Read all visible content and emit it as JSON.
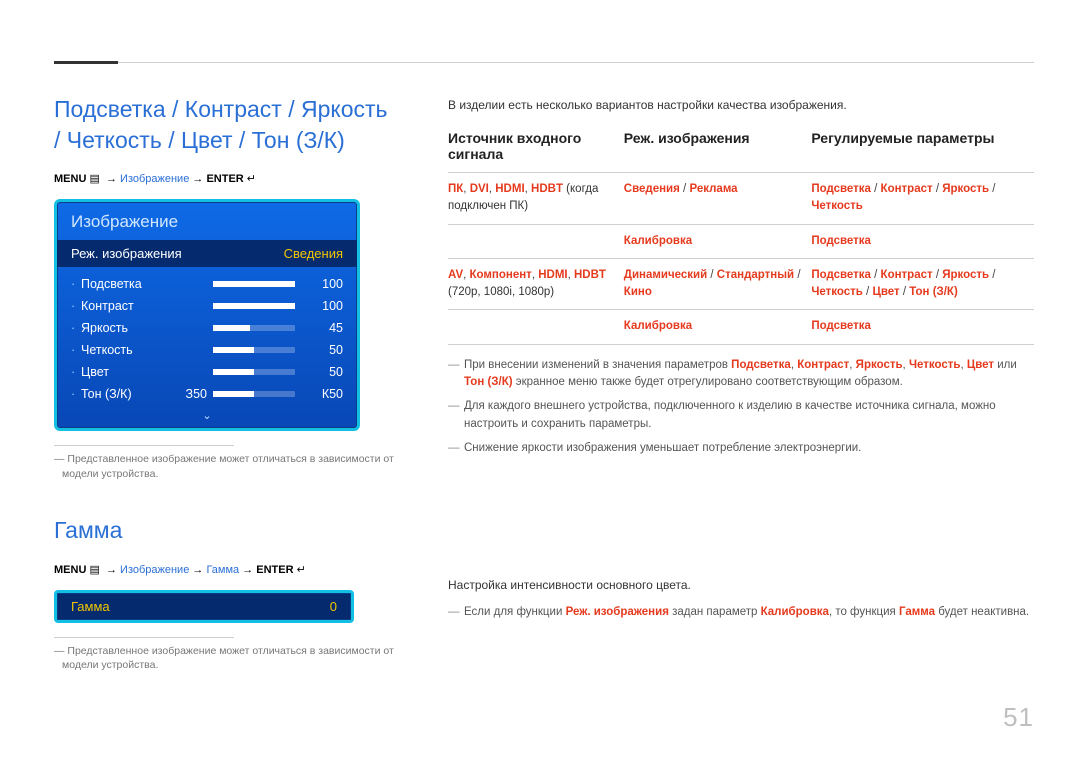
{
  "page_number": "51",
  "section1": {
    "title": "Подсветка / Контраст / Яркость / Четкость / Цвет / Тон (З/К)",
    "menu_path_prefix": "MENU",
    "menu_path_items": [
      "Изображение",
      "ENTER"
    ],
    "osd_title": "Изображение",
    "osd_selected_label": "Реж. изображения",
    "osd_selected_value": "Сведения",
    "sliders": [
      {
        "label": "Подсветка",
        "pre": "",
        "value": "100",
        "pct": 100
      },
      {
        "label": "Контраст",
        "pre": "",
        "value": "100",
        "pct": 100
      },
      {
        "label": "Яркость",
        "pre": "",
        "value": "45",
        "pct": 45
      },
      {
        "label": "Четкость",
        "pre": "",
        "value": "50",
        "pct": 50
      },
      {
        "label": "Цвет",
        "pre": "",
        "value": "50",
        "pct": 50
      },
      {
        "label": "Тон (З/К)",
        "pre": "З50",
        "value": "К50",
        "pct": 50
      }
    ],
    "footnote": "Представленное изображение может отличаться в зависимости от модели устройства."
  },
  "section2": {
    "title": "Гамма",
    "menu_path_prefix": "MENU",
    "menu_path_items": [
      "Изображение",
      "Гамма",
      "ENTER"
    ],
    "osd_label": "Гамма",
    "osd_value": "0",
    "footnote": "Представленное изображение может отличаться в зависимости от модели устройства."
  },
  "right": {
    "lead": "В изделии есть несколько вариантов настройки качества изображения.",
    "headers": [
      "Источник входного сигнала",
      "Реж. изображения",
      "Регулируемые параметры"
    ],
    "rows": [
      {
        "c1_red": "ПК, DVI, HDMI, HDBT",
        "c1_plain": " (когда подключен ПК)",
        "c2": "Сведения / Реклама",
        "c3": "Подсветка / Контраст / Яркость / Четкость"
      },
      {
        "c1_red": "",
        "c1_plain": "",
        "c2": "Калибровка",
        "c3": "Подсветка"
      },
      {
        "c1_red": "AV, Компонент, HDMI, HDBT",
        "c1_plain": " (720p, 1080i, 1080p)",
        "c2": "Динамический / Стандартный / Кино",
        "c3": "Подсветка / Контраст / Яркость / Четкость / Цвет / Тон (З/К)"
      },
      {
        "c1_red": "",
        "c1_plain": "",
        "c2": "Калибровка",
        "c3": "Подсветка"
      }
    ],
    "notes": [
      {
        "pre": "При внесении изменений в значения параметров ",
        "reds": [
          "Подсветка",
          "Контраст",
          "Яркость",
          "Четкость",
          "Цвет"
        ],
        "mid": " или ",
        "last_red": "Тон (З/К)",
        "post": " экранное меню также будет отрегулировано соответствующим образом."
      },
      {
        "plain": "Для каждого внешнего устройства, подключенного к изделию в качестве источника сигнала, можно настроить и сохранить параметры."
      },
      {
        "plain": "Снижение яркости изображения уменьшает потребление электроэнергии."
      }
    ],
    "gamma_lead": "Настройка интенсивности основного цвета.",
    "gamma_note_pre": "Если для функции ",
    "gamma_note_r1": "Реж. изображения",
    "gamma_note_mid1": " задан параметр ",
    "gamma_note_r2": "Калибровка",
    "gamma_note_mid2": ", то функция ",
    "gamma_note_r3": "Гамма",
    "gamma_note_post": " будет неактивна."
  }
}
